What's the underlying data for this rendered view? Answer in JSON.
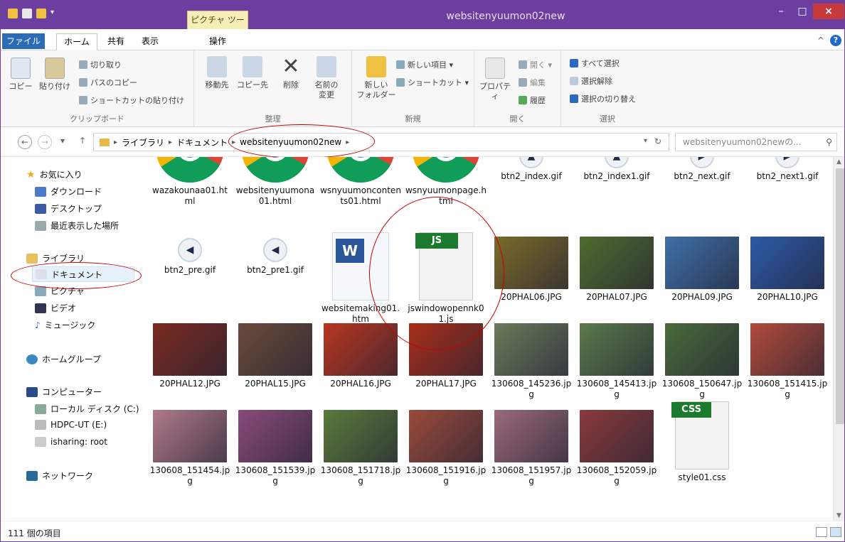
{
  "window": {
    "title": "websitenyuumon02new",
    "context_tab": "ピクチャ ツール"
  },
  "tabs": {
    "file": "ファイル",
    "home": "ホーム",
    "share": "共有",
    "view": "表示",
    "manage": "操作"
  },
  "ribbon": {
    "clipboard": {
      "label": "クリップボード",
      "copy": "コピー",
      "paste": "貼り付け",
      "cut": "切り取り",
      "copy_path": "パスのコピー",
      "paste_shortcut": "ショートカットの貼り付け"
    },
    "organize": {
      "label": "整理",
      "move_to": "移動先",
      "copy_to": "コピー先",
      "delete": "削除",
      "rename": "名前の\n変更"
    },
    "new": {
      "label": "新規",
      "new_folder": "新しい\nフォルダー",
      "new_item": "新しい項目 ▾",
      "shortcut": "ショートカット ▾"
    },
    "open": {
      "label": "開く",
      "properties": "プロパティ",
      "open": "開く ▾",
      "edit": "編集",
      "history": "履歴"
    },
    "select": {
      "label": "選択",
      "select_all": "すべて選択",
      "select_none": "選択解除",
      "invert": "選択の切り替え"
    }
  },
  "address": {
    "library": "ライブラリ",
    "documents": "ドキュメント",
    "current": "websitenyuumon02new",
    "search_placeholder": "websitenyuumon02newの..."
  },
  "nav": {
    "favorites": "お気に入り",
    "downloads": "ダウンロード",
    "desktop": "デスクトップ",
    "recent": "最近表示した場所",
    "libraries": "ライブラリ",
    "documents": "ドキュメント",
    "pictures": "ピクチャ",
    "videos": "ビデオ",
    "music": "ミュージック",
    "homegroup": "ホームグループ",
    "computer": "コンピューター",
    "local_disk": "ローカル ディスク (C:)",
    "hdpc": "HDPC-UT (E:)",
    "isharing": "isharing: root",
    "network": "ネットワーク"
  },
  "files": [
    {
      "name": "wazakounaa01.html",
      "kind": "chrome"
    },
    {
      "name": "websitenyuumona01.html",
      "kind": "chrome"
    },
    {
      "name": "wsnyuumoncontents01.html",
      "kind": "chrome"
    },
    {
      "name": "wsnyuumonpage.html",
      "kind": "chrome"
    },
    {
      "name": "btn2_index.gif",
      "kind": "btn-up"
    },
    {
      "name": "btn2_index1.gif",
      "kind": "btn-up"
    },
    {
      "name": "btn2_next.gif",
      "kind": "btn-right"
    },
    {
      "name": "btn2_next1.gif",
      "kind": "btn-right"
    },
    {
      "name": "btn2_pre.gif",
      "kind": "btn-left"
    },
    {
      "name": "btn2_pre1.gif",
      "kind": "btn-left"
    },
    {
      "name": "websitemaking01.htm",
      "kind": "word"
    },
    {
      "name": "jswindowopennk01.js",
      "kind": "js"
    },
    {
      "name": "20PHAL06.JPG",
      "kind": "photo",
      "color": "#7b6a2a"
    },
    {
      "name": "20PHAL07.JPG",
      "kind": "photo",
      "color": "#4f6b2e"
    },
    {
      "name": "20PHAL09.JPG",
      "kind": "photo",
      "color": "#3f6fa8"
    },
    {
      "name": "20PHAL10.JPG",
      "kind": "photo",
      "color": "#2c5aa8"
    },
    {
      "name": "20PHAL12.JPG",
      "kind": "photo",
      "color": "#7a2a20"
    },
    {
      "name": "20PHAL15.JPG",
      "kind": "photo",
      "color": "#6a4a3a"
    },
    {
      "name": "20PHAL16.JPG",
      "kind": "photo",
      "color": "#b8361f"
    },
    {
      "name": "20PHAL17.JPG",
      "kind": "photo",
      "color": "#a82e1a"
    },
    {
      "name": "130608_145236.jpg",
      "kind": "photo",
      "color": "#6a7a5a"
    },
    {
      "name": "130608_145413.jpg",
      "kind": "photo",
      "color": "#5a7a4a"
    },
    {
      "name": "130608_150647.jpg",
      "kind": "photo",
      "color": "#4a6a3a"
    },
    {
      "name": "130608_151415.jpg",
      "kind": "photo",
      "color": "#b04a3a"
    },
    {
      "name": "130608_151454.jpg",
      "kind": "photo",
      "color": "#b07a8a"
    },
    {
      "name": "130608_151539.jpg",
      "kind": "photo",
      "color": "#8a4a7a"
    },
    {
      "name": "130608_151718.jpg",
      "kind": "photo",
      "color": "#5a7a3a"
    },
    {
      "name": "130608_151916.jpg",
      "kind": "photo",
      "color": "#9a4a3a"
    },
    {
      "name": "130608_151957.jpg",
      "kind": "photo",
      "color": "#9a6a7a"
    },
    {
      "name": "130608_152059.jpg",
      "kind": "photo",
      "color": "#8a3a3a"
    },
    {
      "name": "style01.css",
      "kind": "css"
    }
  ],
  "status": {
    "count": "111 個の項目"
  }
}
